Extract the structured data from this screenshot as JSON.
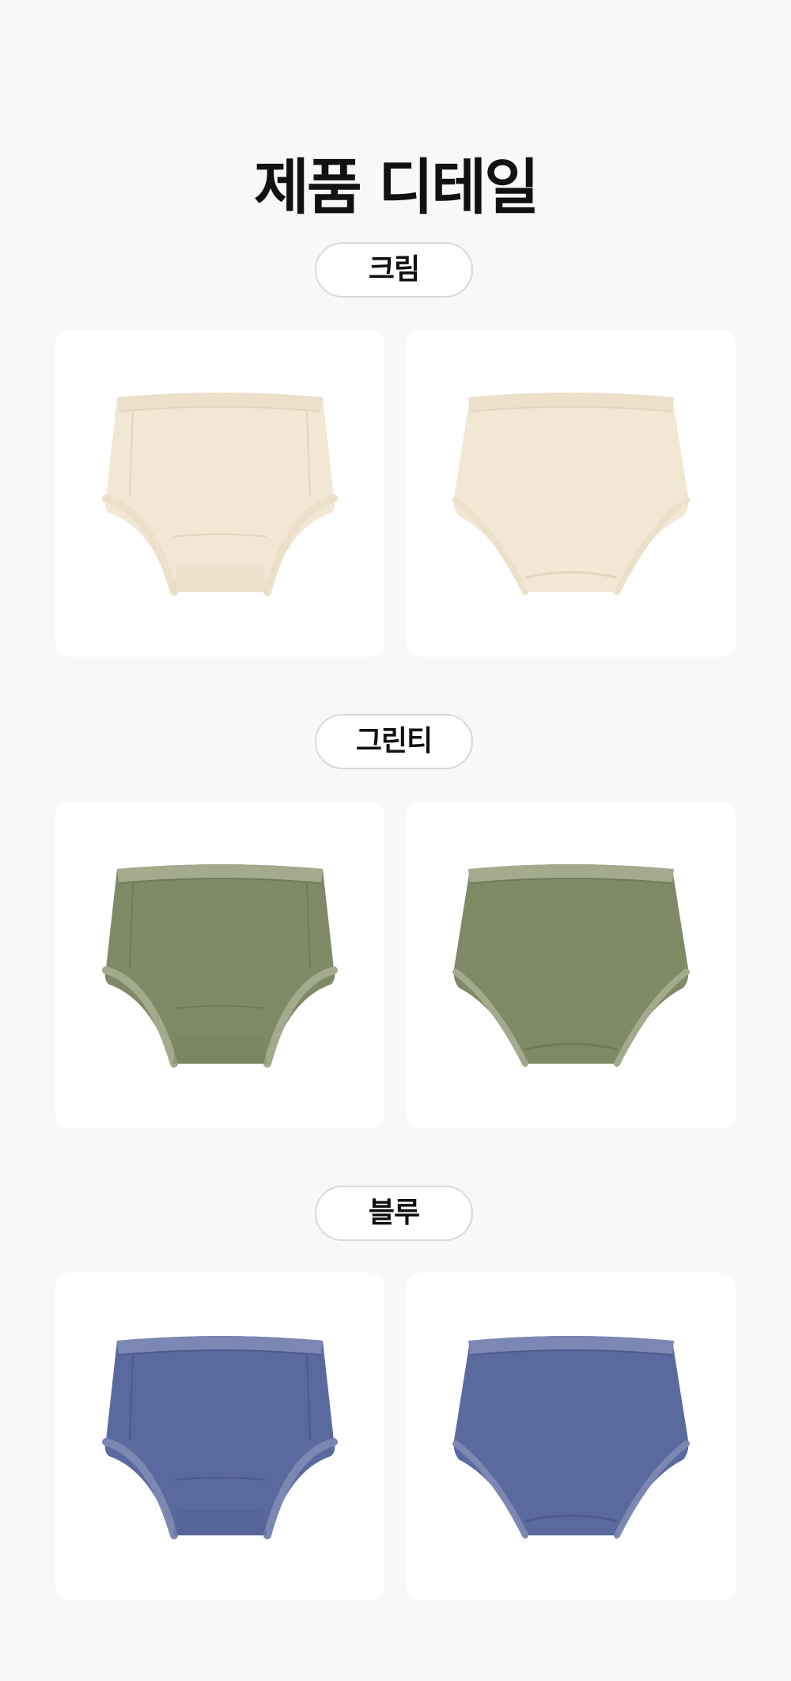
{
  "page": {
    "title": "제품 디테일"
  },
  "sections": [
    {
      "label": "크림",
      "color": "#f2e7d4",
      "shade": "#e4d5bd",
      "trim": "#ece0cb",
      "views": [
        "front-underwear-image",
        "back-underwear-image"
      ]
    },
    {
      "label": "그린티",
      "color": "#7f8966",
      "shade": "#6f7a57",
      "trim": "#a3aa8d",
      "views": [
        "front-underwear-image",
        "back-underwear-image"
      ]
    },
    {
      "label": "블루",
      "color": "#5b6a9e",
      "shade": "#4d5b8d",
      "trim": "#7c88b3",
      "views": [
        "front-underwear-image",
        "back-underwear-image"
      ]
    }
  ]
}
